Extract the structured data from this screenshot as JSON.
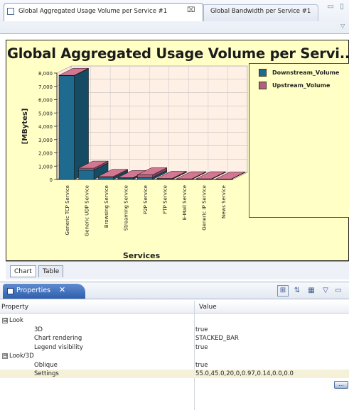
{
  "editor": {
    "active_tab": "Global Aggregated Usage Volume per Service #1",
    "active_tab_close": "⌧",
    "inactive_tab": "Global Bandwidth per Service #1",
    "minimize": "▭",
    "maximize": "▯",
    "view_menu": "▽"
  },
  "chart_data": {
    "type": "bar",
    "stacked": true,
    "style_3d": true,
    "title": "Global Aggregated Usage Volume per Servi...",
    "xlabel": "Services",
    "ylabel": "[MBytes]",
    "ylim": [
      0,
      8000
    ],
    "yticks": [
      "0",
      "1,000",
      "2,000",
      "3,000",
      "4,000",
      "5,000",
      "6,000",
      "7,000",
      "8,000"
    ],
    "categories": [
      "Generic TCP Service",
      "Generic UDP Service",
      "Browsing Service",
      "Streaming Service",
      "P2P Service",
      "FTP Service",
      "E-Mail Service",
      "Generic IP Service",
      "News Service"
    ],
    "series": [
      {
        "name": "Downstream_Volume",
        "color": "#1f6b8f",
        "values": [
          7800,
          700,
          150,
          100,
          150,
          30,
          20,
          20,
          10
        ]
      },
      {
        "name": "Upstream_Volume",
        "color": "#b0627a",
        "values": [
          30,
          150,
          80,
          40,
          200,
          50,
          30,
          30,
          20
        ]
      }
    ],
    "legend_position": "right",
    "grid": true,
    "background": "#ffffc6"
  },
  "view_switch": {
    "chart_tab": "Chart",
    "table_tab": "Table"
  },
  "properties": {
    "tab_label": "Properties",
    "close": "✕",
    "toolbar": [
      "⊞",
      "⇅",
      "▦",
      "▽",
      "▭"
    ],
    "columns": {
      "property": "Property",
      "value": "Value"
    },
    "rows": [
      {
        "kind": "category",
        "name": "Look",
        "expander": "⊟",
        "value": ""
      },
      {
        "kind": "prop",
        "name": "3D",
        "value": "true"
      },
      {
        "kind": "prop",
        "name": "Chart rendering",
        "value": "STACKED_BAR"
      },
      {
        "kind": "prop",
        "name": "Legend visibility",
        "value": "true"
      },
      {
        "kind": "category",
        "name": "Look/3D",
        "expander": "⊟",
        "value": ""
      },
      {
        "kind": "prop",
        "name": "Oblique",
        "value": "true"
      },
      {
        "kind": "prop",
        "name": "Settings",
        "value": "55.0,45.0,20,0,0.97,0.14,0.0,0.0"
      }
    ],
    "ellipsis": "..."
  }
}
